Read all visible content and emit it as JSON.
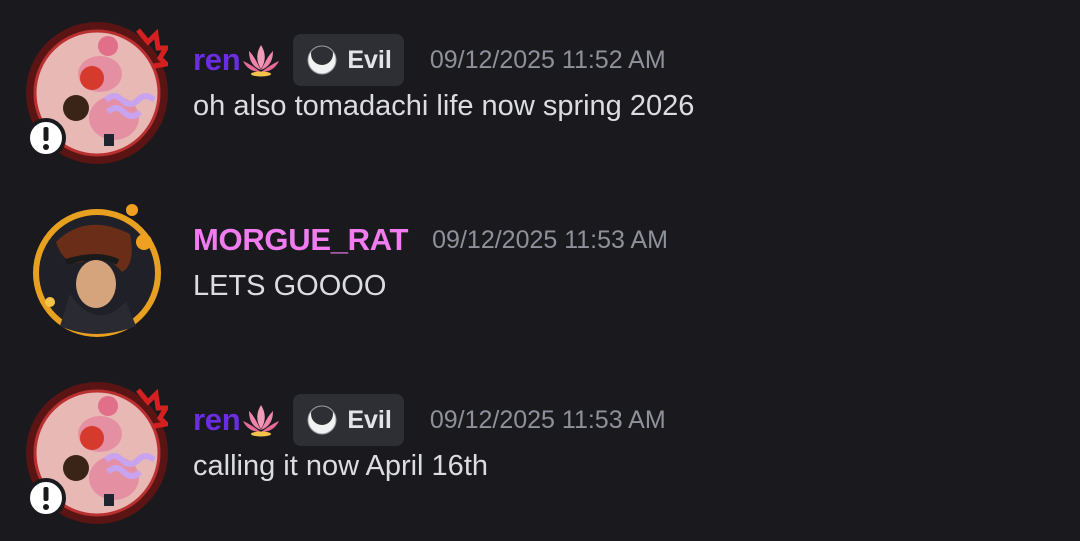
{
  "colors": {
    "background": "#1a1a1e",
    "ren_name": "#6a2ee0",
    "morgue_name": "#f07cf0",
    "timestamp": "#8e919a",
    "message_text": "#dcdde1",
    "tag_background": "#2e2f35"
  },
  "messages": [
    {
      "author": "ren",
      "author_emoji": "lotus-emoji",
      "tag": "Evil",
      "tag_icon": "crescent-moon-icon",
      "timestamp": "09/12/2025 11:52 AM",
      "text": "oh also tomadachi life now spring 2026"
    },
    {
      "author": "MORGUE_RAT",
      "timestamp": "09/12/2025 11:53 AM",
      "text": "LETS GOOOO"
    },
    {
      "author": "ren",
      "author_emoji": "lotus-emoji",
      "tag": "Evil",
      "tag_icon": "crescent-moon-icon",
      "timestamp": "09/12/2025 11:53 AM",
      "text": "calling it now April 16th"
    }
  ]
}
